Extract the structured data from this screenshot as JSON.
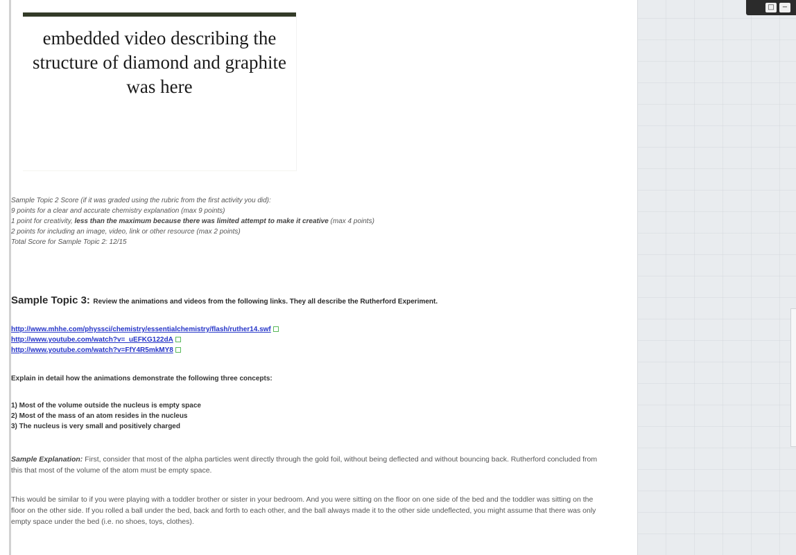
{
  "video": {
    "caption": "embedded video describing the structure of diamond and graphite was here"
  },
  "score": {
    "line1": "Sample Topic 2 Score (if it was graded using the rubric from the first activity you did):",
    "line2": "9 points for a clear and accurate chemistry explanation (max 9 points)",
    "line3_prefix": "1 point for creativity, ",
    "line3_bold": "less than the maximum because there was limited attempt to make it creative",
    "line3_suffix": " (max 4 points)",
    "line4": "2 points for including an image, video, link or other resource (max 2 points)",
    "line5": "Total Score for Sample Topic 2: 12/15"
  },
  "topic3": {
    "heading": "Sample Topic 3:",
    "instruction": "Review the animations and videos from the following links. They all describe the Rutherford Experiment.",
    "links": [
      "http://www.mhhe.com/physsci/chemistry/essentialchemistry/flash/ruther14.swf",
      "http://www.youtube.com/watch?v=_uEFKG122dA",
      "http://www.youtube.com/watch?v=FfY4R5mkMY8"
    ],
    "explain": "Explain in detail how the animations demonstrate the following three concepts:",
    "concepts": [
      "1) Most of the volume outside the nucleus is empty space",
      "2) Most of the mass of an atom resides in the nucleus",
      "3) The nucleus is very small and positively charged"
    ],
    "sample_label": "Sample Explanation:",
    "sample_text": " First, consider that most of the alpha particles went directly through the gold foil, without being deflected and without bouncing back. Rutherford concluded from this that most of the volume of the atom must be empty space.",
    "paragraph2": "This would be similar to if you were playing with a toddler brother or sister in your bedroom. And you were sitting on the floor on one side of the bed and the toddler was sitting on the floor on the other side. If you rolled a ball under the bed, back and forth to each other, and the ball always made it to the other side undeflected, you might assume that there was only empty space under the bed (i.e. no shoes, toys, clothes)."
  },
  "right_panel": {
    "icons": [
      "restore-icon",
      "minimize-icon"
    ]
  }
}
